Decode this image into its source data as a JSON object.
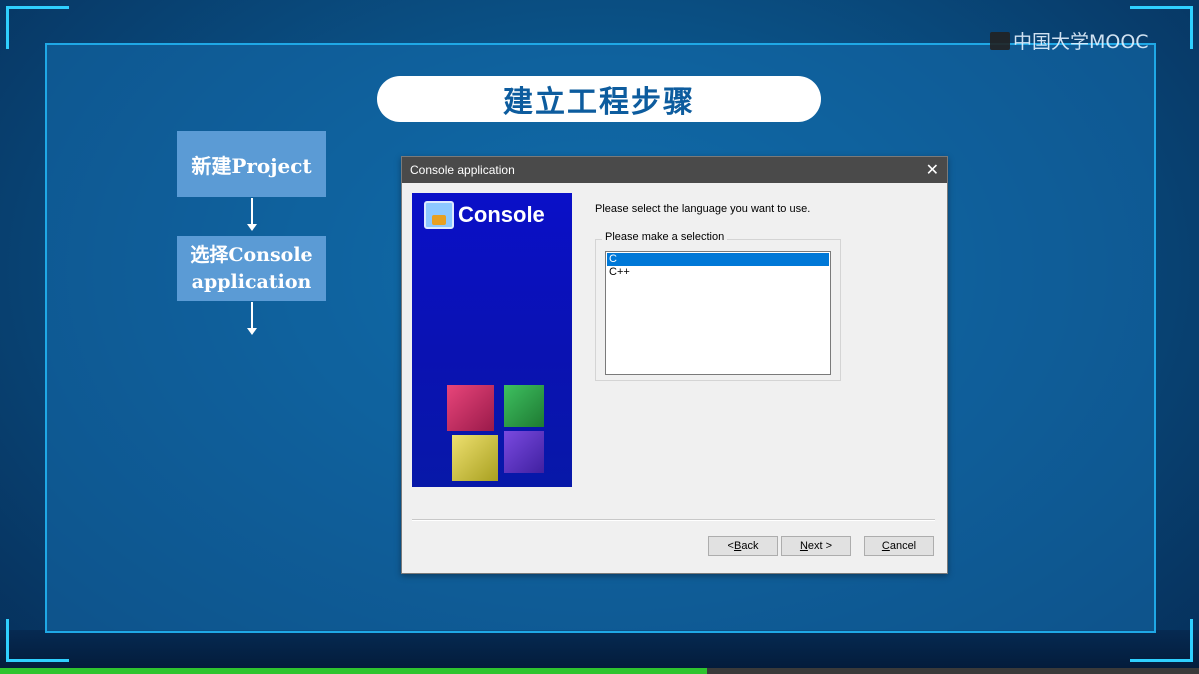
{
  "slide": {
    "title": "建立工程步骤",
    "logo_text": "中国大学MOOC",
    "steps": [
      {
        "label": "新建Project"
      },
      {
        "label": "选择Console application"
      }
    ],
    "video_progress": 0.59
  },
  "dialog": {
    "title": "Console application",
    "banner_title": "Console",
    "prompt": "Please select the language you want to use.",
    "group_label": "Please make a selection",
    "options": [
      "C",
      "C++"
    ],
    "selected_option": "C",
    "buttons": {
      "back": "< Back",
      "next": "Next >",
      "cancel": "Cancel"
    }
  },
  "icons": {
    "close": "close-icon",
    "banner": "console-app-icon",
    "cubes": "codeblocks-logo-icon"
  },
  "colors": {
    "accent": "#2fd0ff",
    "step_box": "#5b9bd5",
    "selection": "#0078d7",
    "banner": "#0a10c8"
  }
}
